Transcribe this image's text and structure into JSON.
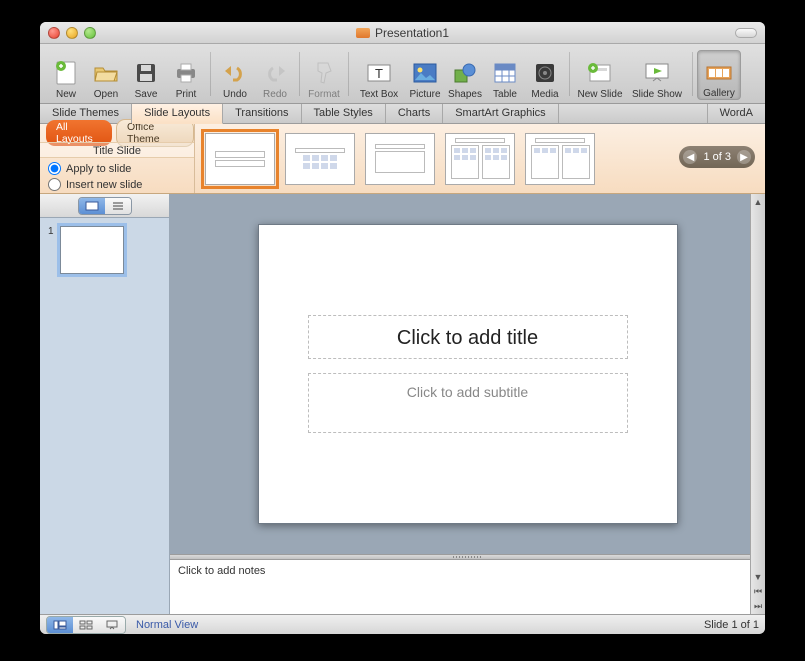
{
  "title": "Presentation1",
  "toolbar": {
    "new": "New",
    "open": "Open",
    "save": "Save",
    "print": "Print",
    "undo": "Undo",
    "redo": "Redo",
    "format": "Format",
    "textbox": "Text Box",
    "picture": "Picture",
    "shapes": "Shapes",
    "table": "Table",
    "media": "Media",
    "newslide": "New Slide",
    "slideshow": "Slide Show",
    "gallery": "Gallery"
  },
  "ribbon": {
    "tabs": [
      "Slide Themes",
      "Slide Layouts",
      "Transitions",
      "Table Styles",
      "Charts",
      "SmartArt Graphics",
      "WordA"
    ],
    "activeIndex": 1
  },
  "layouts": {
    "filterAll": "All Layouts",
    "filterTheme": "Office Theme",
    "title": "Title Slide",
    "applyLabel": "Apply to slide",
    "insertLabel": "Insert new slide",
    "pager": "1 of 3"
  },
  "slide": {
    "number": "1",
    "titlePlaceholder": "Click to add title",
    "subtitlePlaceholder": "Click to add subtitle"
  },
  "notesPlaceholder": "Click to add notes",
  "status": {
    "view": "Normal View",
    "counter": "Slide 1 of 1"
  }
}
